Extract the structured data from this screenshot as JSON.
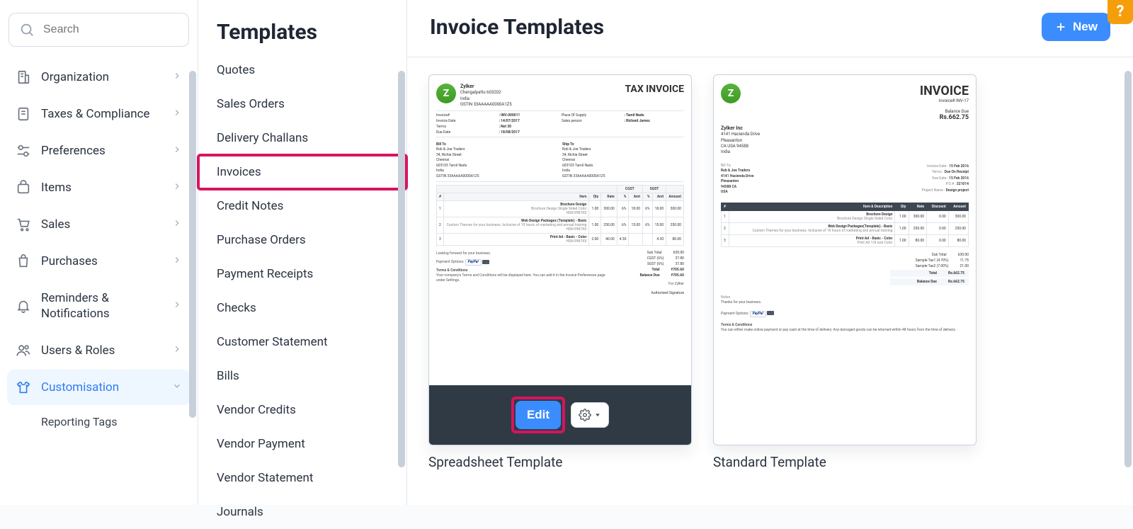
{
  "sidebar": {
    "search_placeholder": "Search",
    "items": [
      {
        "label": "Organization"
      },
      {
        "label": "Taxes & Compliance"
      },
      {
        "label": "Preferences"
      },
      {
        "label": "Items"
      },
      {
        "label": "Sales"
      },
      {
        "label": "Purchases"
      },
      {
        "label": "Reminders & Notifications"
      },
      {
        "label": "Users & Roles"
      },
      {
        "label": "Customisation",
        "active": true
      },
      {
        "label": "Reporting Tags",
        "sub": true
      }
    ]
  },
  "templates": {
    "heading": "Templates",
    "items": [
      "Quotes",
      "Sales Orders",
      "Delivery Challans",
      "Invoices",
      "Credit Notes",
      "Purchase Orders",
      "Payment Receipts",
      "Checks",
      "Customer Statement",
      "Bills",
      "Vendor Credits",
      "Vendor Payment",
      "Vendor Statement",
      "Journals"
    ],
    "selected_index": 3
  },
  "main": {
    "title": "Invoice Templates",
    "new_btn": "New",
    "edit_btn": "Edit",
    "card1_caption": "Spreadsheet Template",
    "card2_caption": "Standard Template",
    "help_label": "?"
  },
  "preview1": {
    "title": "TAX INVOICE",
    "company_name": "Zylker",
    "company_lines": [
      "Chengalpattu 603202",
      "India",
      "GSTIN 33AAAAA0000A1Z5"
    ],
    "meta_left_labels": [
      "Invoice#",
      "Invoice Date",
      "Terms",
      "Due Date"
    ],
    "meta_left_values": [
      "INV-000011",
      "14/07/2017",
      "Net 30",
      "18/08/2017"
    ],
    "meta_right_labels": [
      "Place Of Supply",
      "Sales person"
    ],
    "meta_right_values": [
      "Tamil Nadu",
      "Richard James"
    ],
    "bill_to_label": "Bill To",
    "ship_to_label": "Ship To",
    "address": [
      "Rob & Joe Traders",
      "34, Richie Street",
      "Chennai",
      "603103 Tamil Nadu",
      "India",
      "GSTIN 33AAAAA0000A1Z5"
    ],
    "groups": [
      "CGST",
      "SGST"
    ],
    "columns": [
      "#",
      "Item",
      "Qty",
      "Rate",
      "%",
      "Amt",
      "%",
      "Amt",
      "Amount"
    ],
    "rows": [
      {
        "n": "1",
        "item": "Brochure Design",
        "sub": "Brochure Design Single Sided Color",
        "hsn": "HSN:9987XX",
        "qty": "1.00",
        "rate": "300.00",
        "p1": "6%",
        "a1": "18.00",
        "p2": "6%",
        "a2": "18.00",
        "amt": "300.00"
      },
      {
        "n": "2",
        "item": "Web Design Packages (Template) - Basic",
        "sub": "Custom Themes for your business. Inclusive of 10 hours of marketing and annual training",
        "hsn": "HSN:9987XX",
        "qty": "1.00",
        "rate": "250.00",
        "p1": "6%",
        "a1": "15.00",
        "p2": "6%",
        "a2": "15.00",
        "amt": "250.00"
      },
      {
        "n": "3",
        "item": "Print Ad - Basic - Color",
        "sub": "",
        "hsn": "HSN:9987XX",
        "qty": "2.00",
        "rate": "40.00",
        "p1": "4.30",
        "a1": "",
        "p2": "",
        "a2": "4.30",
        "amt": "80.00"
      }
    ],
    "totals": [
      {
        "label": "Sub Total",
        "value": "630.00"
      },
      {
        "label": "CGST (6%)",
        "value": "37.80"
      },
      {
        "label": "SGST (6%)",
        "value": "37.80"
      },
      {
        "label": "Total",
        "value": "₹705.60",
        "bold": true
      },
      {
        "label": "Balance Due",
        "value": "₹705.60",
        "bold": true
      }
    ],
    "looking_forward": "Looking forward for your business.",
    "payment_options_label": "Payment Options:",
    "terms_heading": "Terms & Conditions",
    "terms_body": "Your company's Terms and Conditions will be displayed here. You can add it in the Invoice Preferences page under Settings.",
    "for_company": "For Zylker",
    "signature": "Authorized Signature"
  },
  "preview2": {
    "title": "INVOICE",
    "invoice_no_label": "Invoice# INV-17",
    "balance_due_label": "Balance Due",
    "balance_due_value": "Rs.662.75",
    "company_name": "Zylker Inc",
    "company_lines": [
      "4141 Hacienda Drive",
      "Pleasanton",
      "CA USA 94588",
      "India"
    ],
    "bill_to_label": "Bill To:",
    "bill_to_lines": [
      "Rob & Joe Traders",
      "4141 Hacienda Drive",
      "Pleasanton",
      "94588 CA",
      "USA"
    ],
    "meta": [
      {
        "label": "Invoice Date :",
        "value": "15 Feb 2016"
      },
      {
        "label": "Terms :",
        "value": "Due On Receipt"
      },
      {
        "label": "Due Date :",
        "value": "15 Feb 2016"
      },
      {
        "label": "P.O.# :",
        "value": "321014"
      },
      {
        "label": "Project Name :",
        "value": "Design project"
      }
    ],
    "columns": [
      "#",
      "Item & Description",
      "Qty",
      "Rate",
      "Discount",
      "Amount"
    ],
    "rows": [
      {
        "n": "1",
        "item": "Brochure Design",
        "sub": "Brochure Design Single Sided Color",
        "qty": "1.00",
        "rate": "300.00",
        "disc": "0.00",
        "amt": "300.00"
      },
      {
        "n": "2",
        "item": "Web Design Packages(Template) - Basic",
        "sub": "Custom Themes for your business. Inclusive of 10 hours of marketing and annual training",
        "qty": "1.00",
        "rate": "250.00",
        "disc": "0.00",
        "amt": "250.00"
      },
      {
        "n": "3",
        "item": "Print Ad - Basic - Color",
        "sub": "Print Ad 1/8 size Color",
        "qty": "1.00",
        "rate": "80.00",
        "disc": "0.00",
        "amt": "80.00"
      }
    ],
    "totals": [
      {
        "label": "Sub Total",
        "value": "630.00"
      },
      {
        "label": "Sample Tax1 (4.70%)",
        "value": "11.75"
      },
      {
        "label": "Sample Tax2 (7.00%)",
        "value": "21.00"
      },
      {
        "label": "Total",
        "value": "Rs.662.75",
        "shade": true,
        "bold": true
      },
      {
        "label": "Balance Due",
        "value": "Rs.662.75",
        "shade": true,
        "bold": true
      }
    ],
    "notes_label": "Notes",
    "notes_body": "Thanks for your business.",
    "payment_options_label": "Payment Options:",
    "terms_heading": "Terms & Conditions",
    "terms_body": "You can either make online payment or pay cash at the time of delivery. Any damaged goods can be returned within 48 hours from the time of delivery."
  }
}
